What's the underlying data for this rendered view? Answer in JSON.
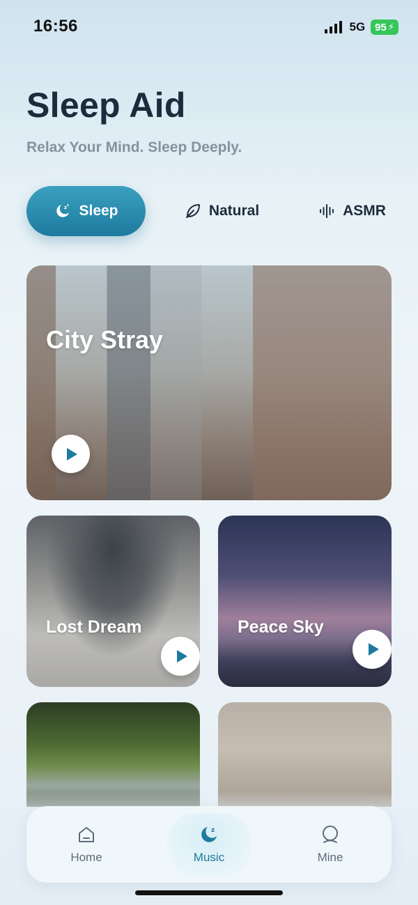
{
  "status": {
    "time": "16:56",
    "network": "5G",
    "battery": "95"
  },
  "header": {
    "title": "Sleep Aid",
    "subtitle": "Relax Your Mind. Sleep Deeply."
  },
  "tabs": [
    {
      "label": "Sleep",
      "icon": "moon-zz-icon",
      "active": true
    },
    {
      "label": "Natural",
      "icon": "leaf-icon",
      "active": false
    },
    {
      "label": "ASMR",
      "icon": "sound-wave-icon",
      "active": false
    }
  ],
  "cards": [
    {
      "title": "City Stray"
    },
    {
      "title": "Lost Dream"
    },
    {
      "title": "Peace Sky"
    },
    {
      "title": ""
    },
    {
      "title": ""
    }
  ],
  "nav": [
    {
      "label": "Home",
      "icon": "home-icon",
      "active": false
    },
    {
      "label": "Music",
      "icon": "music-moon-icon",
      "active": true
    },
    {
      "label": "Mine",
      "icon": "profile-icon",
      "active": false
    }
  ],
  "colors": {
    "accent": "#1e7a9e",
    "title": "#1d2b3d",
    "subtitle": "#8492a0",
    "battery": "#35c759"
  }
}
